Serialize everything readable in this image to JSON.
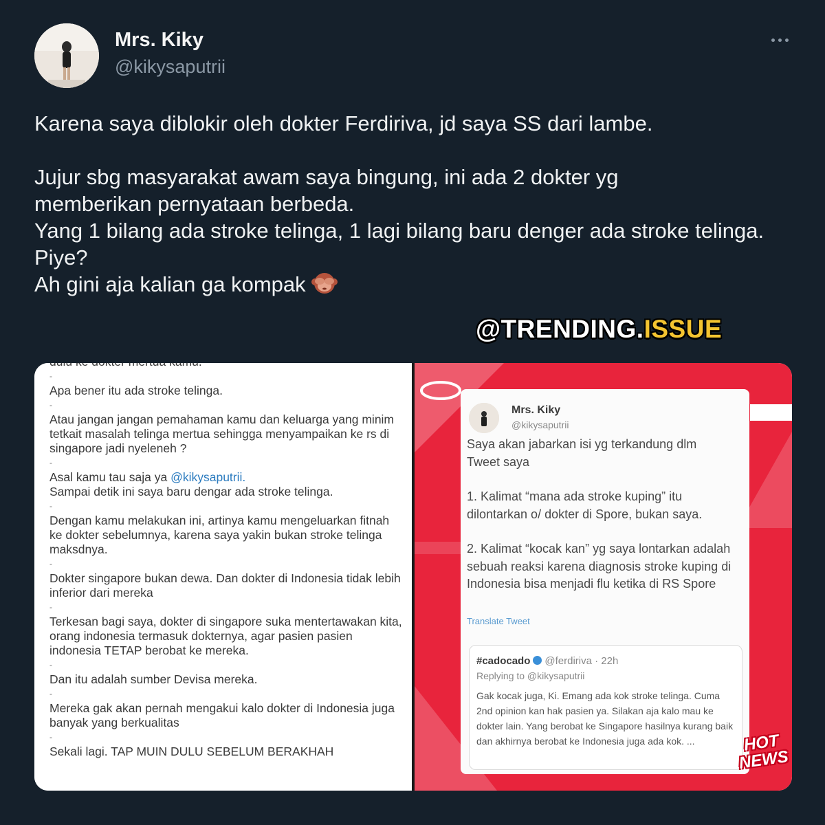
{
  "author": {
    "name": "Mrs. Kiky",
    "handle": "@kikysaputrii"
  },
  "tweet": {
    "paragraphs": [
      "Karena saya diblokir oleh dokter Ferdiriva, jd saya SS dari lambe.",
      "Jujur sbg masyarakat awam saya bingung, ini ada 2 dokter yg memberikan pernyataan berbeda.",
      "Yang 1 bilang ada stroke telinga, 1 lagi bilang baru denger ada stroke telinga.",
      "Piye?",
      "Ah gini aja kalian ga kompak"
    ],
    "emoji": "see-no-evil-monkey"
  },
  "watermark": {
    "part_a": "@TRENDING.",
    "part_b": "ISSUE"
  },
  "left_screenshot": {
    "lines": [
      "dulu ke dokter mertua kamu.",
      "Apa bener itu ada stroke telinga.",
      "Atau jangan jangan pemahaman kamu dan keluarga yang minim tetkait masalah telinga mertua sehingga menyampaikan ke rs di singapore jadi nyeleneh ?",
      "Asal kamu tau saja ya",
      "@kikysaputrii.",
      "Sampai detik ini saya baru dengar ada stroke telinga.",
      "Dengan kamu melakukan ini, artinya kamu mengeluarkan fitnah ke dokter sebelumnya, karena saya yakin bukan stroke telinga maksdnya.",
      "Dokter singapore bukan dewa. Dan dokter di Indonesia tidak lebih inferior dari mereka",
      "Terkesan bagi saya, dokter di singapore suka mentertawakan kita, orang indonesia termasuk dokternya, agar pasien pasien indonesia TETAP berobat ke mereka.",
      "Dan itu adalah sumber Devisa mereka.",
      "Mereka gak akan pernah mengakui kalo dokter di Indonesia juga banyak yang berkualitas",
      "Sekali lagi. TAP MUIN DULU SEBELUM BERAKHAH"
    ]
  },
  "right_screenshot": {
    "name": "Mrs. Kiky",
    "handle": "@kikysaputrii",
    "text_intro": "Saya akan jabarkan isi yg terkandung dlm Tweet saya",
    "point1": "1. Kalimat “mana ada stroke kuping” itu dilontarkan o/ dokter di Spore, bukan saya.",
    "point2": "2. Kalimat “kocak kan” yg saya lontarkan adalah sebuah reaksi karena diagnosis stroke kuping di Indonesia bisa menjadi flu ketika di RS Spore",
    "translate": "Translate Tweet",
    "quote": {
      "name": "#cadocado",
      "handle": "@ferdiriva",
      "time": "22h",
      "replying": "Replying to @kikysaputrii",
      "text": "Gak kocak juga, Ki. Emang ada kok stroke telinga. Cuma 2nd opinion kan hak pasien ya. Silakan aja kalo mau ke dokter lain. Yang berobat ke Singapore hasilnya kurang baik dan akhirnya berobat ke Indonesia juga ada kok. ..."
    },
    "badge_line1": "HOT",
    "badge_line2": "NEWS",
    "accent": "#e8243c"
  }
}
